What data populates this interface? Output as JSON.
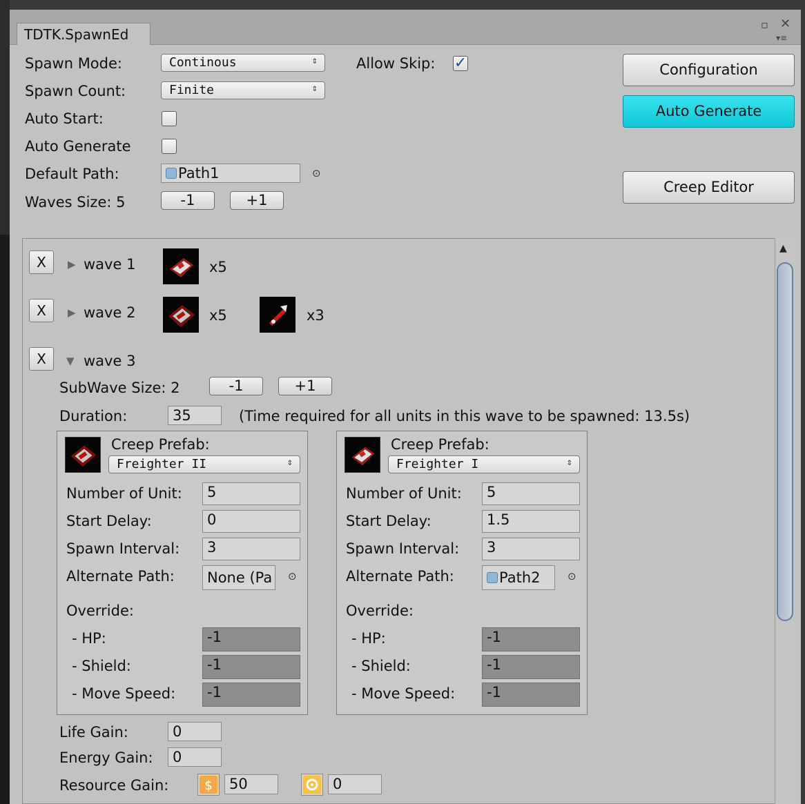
{
  "window": {
    "tab_title": "TDTK.SpawnEd",
    "maximize_glyph": "▫",
    "close_glyph": "✕",
    "menu_glyph": "▾≡"
  },
  "settings": {
    "spawn_mode": {
      "label": "Spawn Mode:",
      "value": "Continous"
    },
    "spawn_count": {
      "label": "Spawn Count:",
      "value": "Finite"
    },
    "allow_skip": {
      "label": "Allow Skip:",
      "checked": true
    },
    "auto_start": {
      "label": "Auto Start:",
      "checked": false
    },
    "auto_generate": {
      "label": "Auto Generate",
      "checked": false
    },
    "default_path": {
      "label": "Default Path:",
      "value": "Path1"
    },
    "waves_size": {
      "label": "Waves Size: 5",
      "minus": "-1",
      "plus": "+1"
    }
  },
  "actions": {
    "configuration": "Configuration",
    "auto_generate": "Auto Generate",
    "creep_editor": "Creep Editor",
    "accent_color": "#1fd3e0"
  },
  "waves": [
    {
      "remove": "X",
      "label": "wave 1",
      "expanded": false,
      "creeps": [
        {
          "count": "x5",
          "icon": "freighter-creep-icon"
        }
      ]
    },
    {
      "remove": "X",
      "label": "wave 2",
      "expanded": false,
      "creeps": [
        {
          "count": "x5",
          "icon": "freighter-creep-icon"
        },
        {
          "count": "x3",
          "icon": "drone-creep-icon"
        }
      ]
    },
    {
      "remove": "X",
      "label": "wave 3",
      "expanded": true
    }
  ],
  "wave3": {
    "subwave_size": {
      "label": "SubWave Size: 2",
      "minus": "-1",
      "plus": "+1"
    },
    "duration": {
      "label": "Duration:",
      "value": "35",
      "note": "(Time required for all units in this wave to be spawned: 13.5s)"
    },
    "subwaves": [
      {
        "prefab_label": "Creep Prefab:",
        "prefab": "Freighter II",
        "number_of_unit": {
          "label": "Number of Unit:",
          "value": "5"
        },
        "start_delay": {
          "label": "Start Delay:",
          "value": "0"
        },
        "spawn_interval": {
          "label": "Spawn Interval:",
          "value": "3"
        },
        "alternate_path": {
          "label": "Alternate Path:",
          "value": "None (Pa"
        },
        "override_label": "Override:",
        "hp": {
          "label": "- HP:",
          "value": "-1"
        },
        "shield": {
          "label": "- Shield:",
          "value": "-1"
        },
        "move_speed": {
          "label": "- Move Speed:",
          "value": "-1"
        }
      },
      {
        "prefab_label": "Creep Prefab:",
        "prefab": "Freighter I",
        "number_of_unit": {
          "label": "Number of Unit:",
          "value": "5"
        },
        "start_delay": {
          "label": "Start Delay:",
          "value": "1.5"
        },
        "spawn_interval": {
          "label": "Spawn Interval:",
          "value": "3"
        },
        "alternate_path": {
          "label": "Alternate Path:",
          "value": "Path2"
        },
        "override_label": "Override:",
        "hp": {
          "label": "- HP:",
          "value": "-1"
        },
        "shield": {
          "label": "- Shield:",
          "value": "-1"
        },
        "move_speed": {
          "label": "- Move Speed:",
          "value": "-1"
        }
      }
    ],
    "life_gain": {
      "label": "Life Gain:",
      "value": "0"
    },
    "energy_gain": {
      "label": "Energy Gain:",
      "value": "0"
    },
    "resource_gain": {
      "label": "Resource Gain:",
      "values": [
        "50",
        "0"
      ]
    }
  }
}
